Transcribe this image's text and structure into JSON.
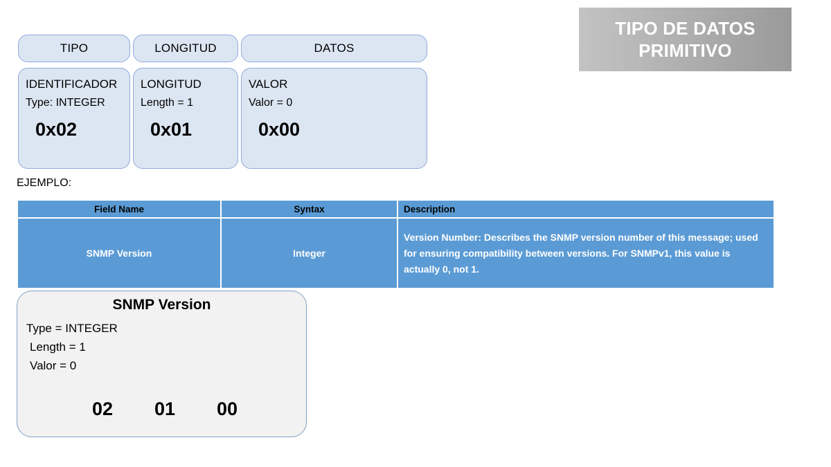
{
  "title_banner": {
    "line1": "TIPO DE DATOS",
    "line2": "PRIMITIVO",
    "bg_color_start": "#c3c3c3",
    "bg_color_end": "#9a9a9a",
    "text_color": "#ffffff"
  },
  "tlv_header_boxes": [
    {
      "label": "TIPO"
    },
    {
      "label": "LONGITUD"
    },
    {
      "label": "DATOS"
    }
  ],
  "tlv_detail_boxes": [
    {
      "title": "IDENTIFICADOR",
      "detail": "Type: INTEGER",
      "hex": "0x02"
    },
    {
      "title": "LONGITUD",
      "detail": "Length = 1",
      "hex": "0x01"
    },
    {
      "title": "VALOR",
      "detail": "Valor = 0",
      "hex": "0x00"
    }
  ],
  "example_label": "EJEMPLO:",
  "table": {
    "accent_color": "#5b9bd5",
    "header_text_color": "#000000",
    "body_text_color": "#ffffff",
    "headers": [
      "Field Name",
      "Syntax",
      "Description"
    ],
    "rows": [
      {
        "field_name": "SNMP Version",
        "syntax": "Integer",
        "description": "Version Number: Describes the SNMP version number of this message; used for ensuring compatibility between versions. For SNMPv1, this value is actually 0, not 1."
      }
    ]
  },
  "example_box": {
    "title": "SNMP Version",
    "lines": [
      "Type = INTEGER",
      "Length = 1",
      "Valor = 0"
    ],
    "hex_bytes": [
      "02",
      "01",
      "00"
    ],
    "bg_color": "#f2f2f2",
    "border_color": "#7f9fc4"
  }
}
